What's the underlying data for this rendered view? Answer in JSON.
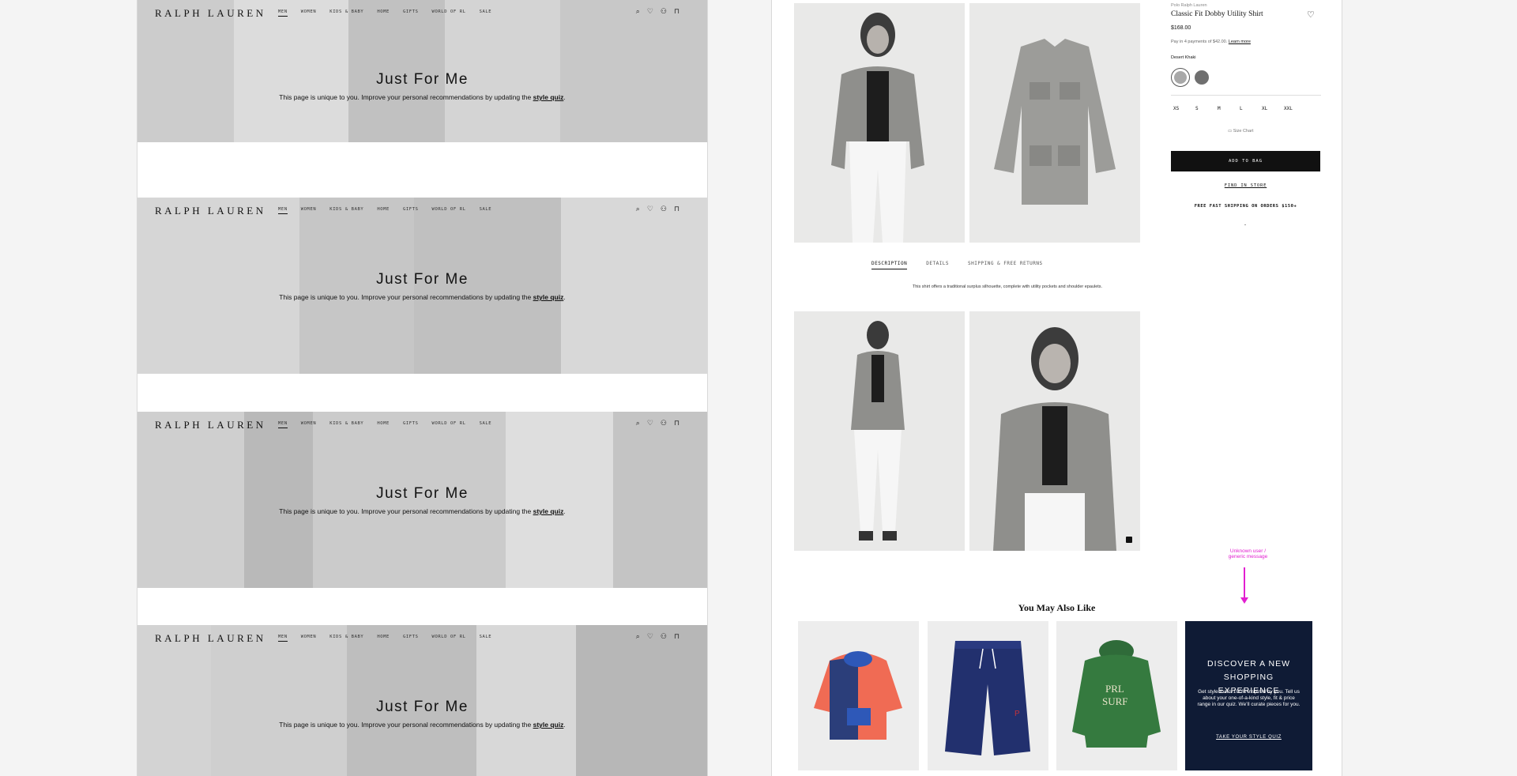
{
  "left_board": {
    "nav": {
      "logo": "RALPH LAUREN",
      "links": [
        "MEN",
        "WOMEN",
        "KIDS & BABY",
        "HOME",
        "GIFTS",
        "WORLD OF RL",
        "SALE"
      ],
      "active_link": "MEN",
      "icons": [
        "search-icon",
        "heart-icon",
        "account-icon",
        "bag-icon"
      ]
    },
    "hero": {
      "title": "Just For Me",
      "subtitle_prefix": "This page is unique to you. Improve your personal recommendations by updating the ",
      "subtitle_link": "style quiz",
      "subtitle_suffix": "."
    },
    "variants": 4
  },
  "product": {
    "brand": "Polo Ralph Lauren",
    "name": "Classic Fit Dobby Utility Shirt",
    "price": "$168.00",
    "installments_text": "Pay in 4 payments of $42.00. ",
    "installments_link": "Learn more",
    "color_label": "Desert Khaki",
    "swatches": [
      "#a8a8a8",
      "#6f6f6f"
    ],
    "sizes": [
      "XS",
      "S",
      "M",
      "L",
      "XL",
      "XXL"
    ],
    "size_chart": "Size Chart",
    "add_to_bag": "ADD TO BAG",
    "find_in_store": "FIND IN STORE",
    "shipping": "FREE FAST SHIPPING ON ORDERS $150+",
    "tabs": [
      "DESCRIPTION",
      "DETAILS",
      "SHIPPING & FREE RETURNS"
    ],
    "active_tab": "DESCRIPTION",
    "description": "This shirt offers a traditional surplus silhouette, complete with utility pockets and shoulder epaulets."
  },
  "annotation": {
    "text_line1": "Unknown user /",
    "text_line2": "generic message",
    "color": "#e21fd0"
  },
  "recommendations": {
    "title": "You May Also Like",
    "items": [
      "colorblock-hoodie",
      "navy-shorts",
      "green-surf-hoodie"
    ],
    "promo": {
      "title_line1": "DISCOVER A NEW",
      "title_line2": "SHOPPING EXPERIENCE",
      "body": "Get style that’s 100% inspired by you. Tell us about your one-of-a-kind style, fit & price range in our quiz. We’ll curate pieces for you.",
      "link": "TAKE YOUR STYLE QUIZ",
      "bg_color": "#0f1b35"
    }
  }
}
